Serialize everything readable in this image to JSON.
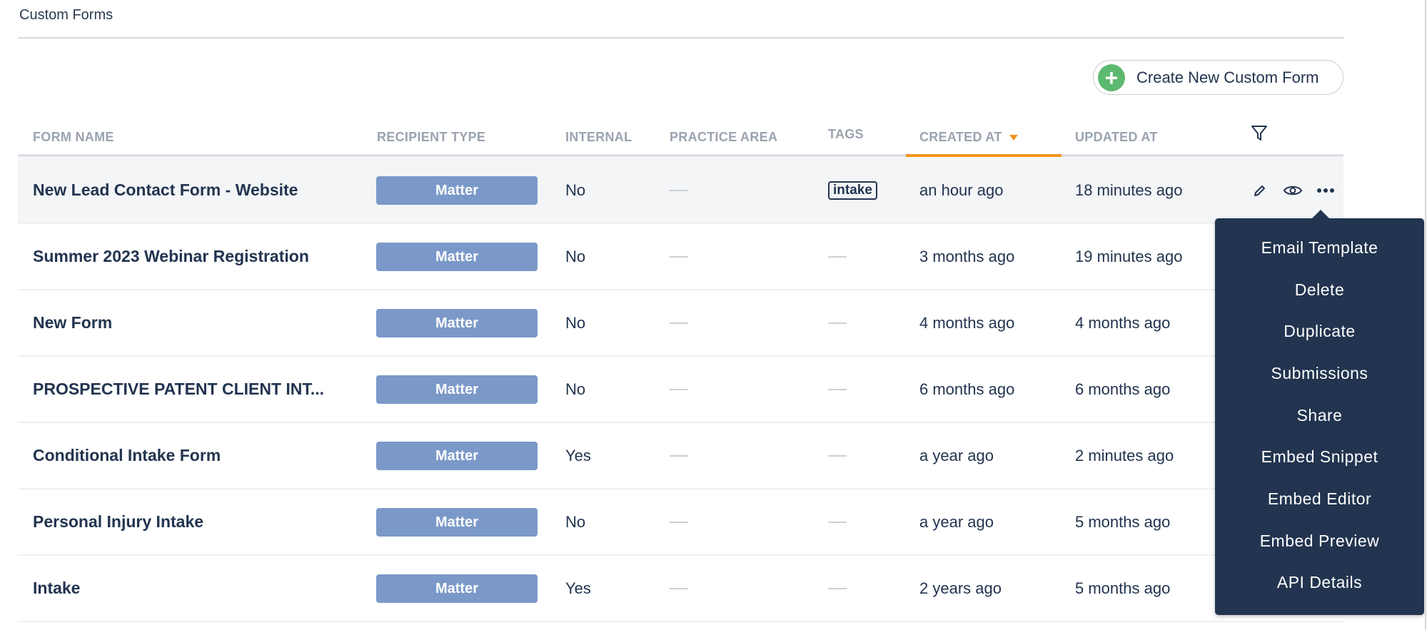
{
  "page": {
    "title": "Custom Forms",
    "create_button": "Create New Custom Form"
  },
  "columns": {
    "form_name": "FORM NAME",
    "recipient_type": "RECIPIENT TYPE",
    "internal": "INTERNAL",
    "practice_area": "PRACTICE AREA",
    "tags": "TAGS",
    "created_at": "CREATED AT",
    "updated_at": "UPDATED AT"
  },
  "sort": {
    "column": "created_at",
    "direction": "desc"
  },
  "rows": [
    {
      "name": "New Lead Contact Form - Website",
      "recipient": "Matter",
      "internal": "No",
      "practice_area": "",
      "tag": "intake",
      "created": "an hour ago",
      "updated": "18 minutes ago"
    },
    {
      "name": "Summer 2023 Webinar Registration",
      "recipient": "Matter",
      "internal": "No",
      "practice_area": "",
      "tag": "",
      "created": "3 months ago",
      "updated": "19 minutes ago"
    },
    {
      "name": "New Form",
      "recipient": "Matter",
      "internal": "No",
      "practice_area": "",
      "tag": "",
      "created": "4 months ago",
      "updated": "4 months ago"
    },
    {
      "name": "PROSPECTIVE PATENT CLIENT INT...",
      "recipient": "Matter",
      "internal": "No",
      "practice_area": "",
      "tag": "",
      "created": "6 months ago",
      "updated": "6 months ago"
    },
    {
      "name": "Conditional Intake Form",
      "recipient": "Matter",
      "internal": "Yes",
      "practice_area": "",
      "tag": "",
      "created": "a year ago",
      "updated": "2 minutes ago"
    },
    {
      "name": "Personal Injury Intake",
      "recipient": "Matter",
      "internal": "No",
      "practice_area": "",
      "tag": "",
      "created": "a year ago",
      "updated": "5 months ago"
    },
    {
      "name": "Intake",
      "recipient": "Matter",
      "internal": "Yes",
      "practice_area": "",
      "tag": "",
      "created": "2 years ago",
      "updated": "5 months ago"
    }
  ],
  "menu": [
    "Email Template",
    "Delete",
    "Duplicate",
    "Submissions",
    "Share",
    "Embed Snippet",
    "Embed Editor",
    "Embed Preview",
    "API Details"
  ],
  "colors": {
    "primary": "#22344f",
    "badge": "#7b99c8",
    "accent": "#f39221",
    "add": "#5cb96f"
  },
  "icons": {
    "add": "plus-circle-icon",
    "filter": "filter-icon",
    "edit": "pencil-icon",
    "view": "eye-icon",
    "more": "more-horizontal-icon"
  }
}
